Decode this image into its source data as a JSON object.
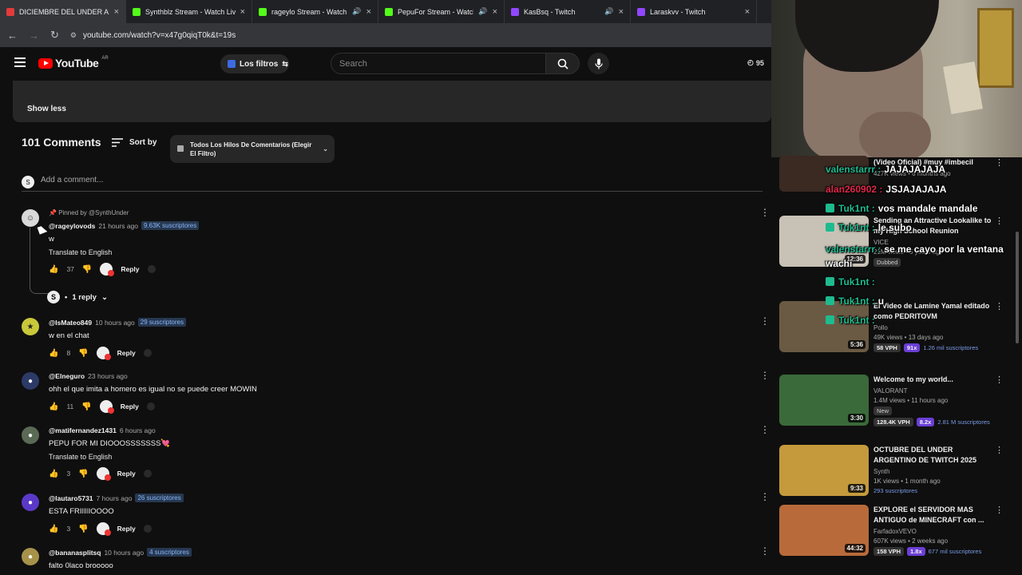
{
  "browser": {
    "tabs": [
      {
        "title": "DICIEMBRE DEL UNDER ARGEN",
        "color": "#e33b3b",
        "active": true,
        "audio": false
      },
      {
        "title": "Synthblz Stream - Watch Live o",
        "color": "#53fc18",
        "active": false,
        "audio": false
      },
      {
        "title": "rageylo Stream - Watch Live",
        "color": "#53fc18",
        "active": false,
        "audio": true
      },
      {
        "title": "PepuFor Stream - Watch Live",
        "color": "#53fc18",
        "active": false,
        "audio": true
      },
      {
        "title": "KasBsq - Twitch",
        "color": "#9146ff",
        "active": false,
        "audio": true
      },
      {
        "title": "Laraskvv - Twitch",
        "color": "#9146ff",
        "active": false,
        "audio": false
      }
    ],
    "url": "youtube.com/watch?v=x47g0qiqT0k&t=19s"
  },
  "header": {
    "logo_text": "YouTube",
    "region": "AR",
    "filter_label": "Los filtros",
    "search_placeholder": "Search",
    "counter": "95"
  },
  "description": {
    "show_less": "Show less"
  },
  "comments_header": {
    "count": "101 Comments",
    "sort_label": "Sort by",
    "threads_filter": "Todos Los Hilos De Comentarios (Elegir El Filtro)",
    "add_placeholder": "Add a comment..."
  },
  "comments": [
    {
      "pinned": "Pinned by @SynthUnder",
      "user": "@rageylovods",
      "time": "21 hours ago",
      "badge": "9.63K suscriptores",
      "text": "w",
      "translate": "Translate to English",
      "likes": "37",
      "reply": "Reply",
      "avatar_color": "#d9d9d9"
    },
    {
      "user": "@IsMateo849",
      "time": "10 hours ago",
      "badge": "29 suscriptores",
      "text": "w en el chat",
      "likes": "8",
      "reply": "Reply",
      "avatar_color": "#c8c83a"
    },
    {
      "user": "@Elneguro",
      "time": "23 hours ago",
      "badge": "",
      "text": "ohh el que imita a homero es igual no se puede creer MOWIN",
      "likes": "11",
      "reply": "Reply",
      "avatar_color": "#2c3a66"
    },
    {
      "user": "@matifernandez1431",
      "time": "6 hours ago",
      "badge": "",
      "text": "PEPU FOR MI DIOOOSSSSSSS💘",
      "translate": "Translate to English",
      "likes": "3",
      "reply": "Reply",
      "avatar_color": "#5a6a55"
    },
    {
      "user": "@lautaro5731",
      "time": "7 hours ago",
      "badge": "26 suscriptores",
      "text": "ESTA FRIIIIIOOOO",
      "likes": "3",
      "reply": "Reply",
      "avatar_color": "#5a39c9"
    },
    {
      "user": "@bananasplitsq",
      "time": "10 hours ago",
      "badge": "4 suscriptores",
      "text": "falto 0laco brooooo",
      "likes": "",
      "reply": "Reply",
      "avatar_color": "#a6924a"
    }
  ],
  "replies_toggle": "1 reply",
  "sidebar_videos": [
    {
      "title": "(Video Oficial) #muy #imbecil",
      "channel": "",
      "stats": "427K views • 6 months ago",
      "duration": "",
      "thumb": "#3a2a22"
    },
    {
      "title": "Sending an Attractive Lookalike to my High School Reunion",
      "channel": "VICE",
      "stats": "21M views • 5 years ago",
      "duration": "12:36",
      "tag": "Dubbed",
      "thumb": "#c8c2b6"
    },
    {
      "title": "El Video de Lamine Yamal editado como PEDRITOVM",
      "channel": "Pollo",
      "stats": "49K views • 13 days ago",
      "duration": "5:36",
      "vph": "58 VPH",
      "mult": "91x",
      "subs": "1.26 mil suscriptores",
      "thumb": "#6a5a44"
    },
    {
      "title": "Welcome to my world...",
      "channel": "VALORANT",
      "stats": "1.4M views • 11 hours ago",
      "duration": "3:30",
      "new": "New",
      "vph": "128.4K VPH",
      "mult": "8.2x",
      "subs": "2.81 M suscriptores",
      "thumb": "#3a6a3a"
    },
    {
      "title": "OCTUBRE DEL UNDER ARGENTINO DE TWITCH 2025",
      "channel": "Synth",
      "stats": "1K views • 1 month ago",
      "duration": "9:33",
      "subs": "293 suscriptores",
      "thumb": "#c49a3c"
    },
    {
      "title": "EXPLORE el SERVIDOR MAS ANTIGUO de MINECRAFT con ...",
      "channel": "FarfadoxVEVO",
      "stats": "607K views • 2 weeks ago",
      "duration": "44:32",
      "vph": "158 VPH",
      "mult": "1.8x",
      "subs": "677 mil suscriptores",
      "thumb": "#b86a3a"
    }
  ],
  "chat": [
    {
      "name": "valenstarrr :",
      "text": "JAJAJAJAJA",
      "color": "#1dbb8f"
    },
    {
      "name": "alan260902 :",
      "text": "JSJAJAJAJA",
      "color": "#e0284a"
    },
    {
      "name": "Tuk1nt :",
      "text": "vos mandale mandale",
      "color": "#1dbb8f"
    },
    {
      "name": "Tuk1nt :",
      "text": "le subo",
      "color": "#1dbb8f"
    },
    {
      "name": "valenstarrr :",
      "text": "se me cayo por la ventana wachi",
      "color": "#1dbb8f"
    },
    {
      "name": "Tuk1nt :",
      "text": "",
      "color": "#1dbb8f"
    },
    {
      "name": "Tuk1nt :",
      "text": "u",
      "color": "#1dbb8f"
    },
    {
      "name": "Tuk1nt :",
      "text": "",
      "color": "#1dbb8f"
    }
  ]
}
